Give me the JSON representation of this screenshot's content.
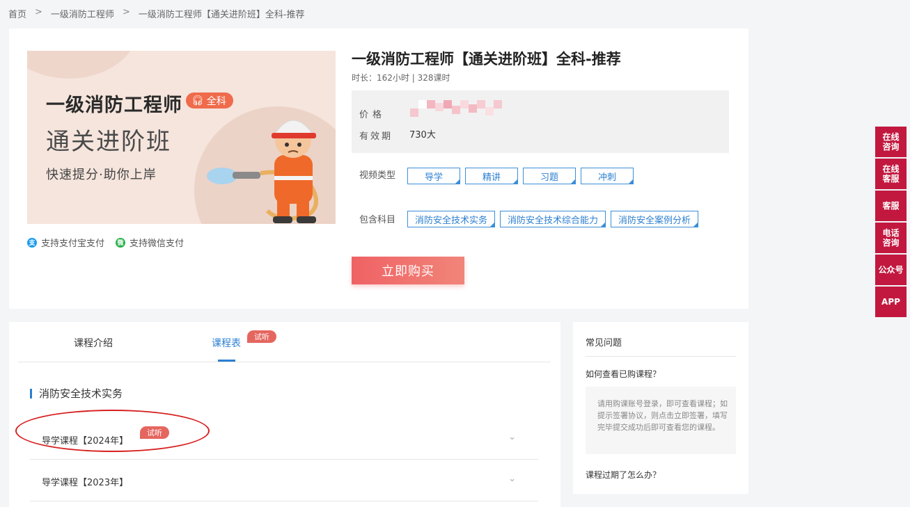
{
  "breadcrumb": {
    "home": "首页",
    "sep": ">",
    "level1": "一级消防工程师",
    "current": "一级消防工程师【通关进阶班】全科-推荐"
  },
  "banner": {
    "title": "一级消防工程师",
    "tag": "全科",
    "subtitle": "通关进阶班",
    "slogan": "快速提分·助你上岸"
  },
  "payment": {
    "alipay": "支持支付宝支付",
    "wechat": "支持微信支付"
  },
  "course": {
    "title": "一级消防工程师【通关进阶班】全科-推荐",
    "meta": "时长：162小时 | 328课时",
    "price_label": "价格",
    "validity_label": "有效期",
    "validity_value": "730大",
    "video_type_label": "视频类型",
    "video_types": [
      "导学",
      "精讲",
      "习题",
      "冲刺"
    ],
    "subjects_label": "包含科目",
    "subjects": [
      "消防安全技术实务",
      "消防安全技术综合能力",
      "消防安全案例分析"
    ],
    "buy_label": "立即购买"
  },
  "tabs": {
    "intro": "课程介绍",
    "schedule": "课程表",
    "trial": "试听"
  },
  "section": {
    "title": "消防安全技术实务",
    "lessons": [
      {
        "name": "导学课程【2024年】",
        "badge": "试听"
      },
      {
        "name": "导学课程【2023年】"
      }
    ]
  },
  "faq": {
    "title": "常见问题",
    "q1": "如何查看已购课程？",
    "a1": "请用购课账号登录，即可查看课程；如提示签署协议，则点击立即签署，填写完毕提交成功后即可查看您的课程。",
    "q2": "课程过期了怎么办？"
  },
  "side_nav": [
    "在线\n咨询",
    "在线\n客服",
    "客服",
    "电话\n咨询",
    "公众号",
    "APP"
  ],
  "colors": {
    "accent": "#2b7fd0",
    "buy_button": "#ef6264",
    "side_nav": "#c2183f",
    "highlight": "#d6201f"
  }
}
